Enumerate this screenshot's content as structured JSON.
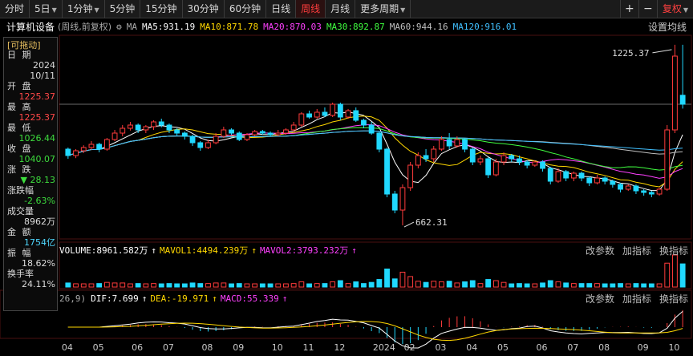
{
  "toolbar": {
    "periods": [
      "分时",
      "5日",
      "1分钟",
      "5分钟",
      "15分钟",
      "30分钟",
      "60分钟",
      "日线",
      "周线",
      "月线",
      "更多周期"
    ],
    "active": "周线",
    "fuquan": "复权",
    "plus": "+",
    "minus": "−"
  },
  "header": {
    "stock_name": "计算机设备",
    "period_note": "(周线,前复权)",
    "ma_label": "MA",
    "ma": [
      {
        "label": "MA5:931.19",
        "color": "#ffffff"
      },
      {
        "label": "MA10:871.78",
        "color": "#ffd700"
      },
      {
        "label": "MA20:870.03",
        "color": "#ff40ff"
      },
      {
        "label": "MA30:892.87",
        "color": "#40ff40"
      },
      {
        "label": "MA60:944.16",
        "color": "#c0c0c0"
      },
      {
        "label": "MA120:916.01",
        "color": "#40c0ff"
      }
    ],
    "settings": "设置均线"
  },
  "panel": {
    "drag": "[可拖动]",
    "date_label": "日  期",
    "year": "2024",
    "date": "10/11",
    "open_label": "开  盘",
    "open": "1225.37",
    "high_label": "最  高",
    "high": "1225.37",
    "low_label": "最  低",
    "low": "1026.44",
    "close_label": "收  盘",
    "close": "1040.07",
    "change_label": "涨  跌",
    "change": "▼ 28.13",
    "pct_label": "涨跌幅",
    "pct": "-2.63%",
    "vol_label": "成交量",
    "vol": "8962万",
    "amount_label": "金  额",
    "amount": "1754亿",
    "amp_label": "振  幅",
    "amp": "18.62%",
    "turnover_label": "换手率",
    "turnover": "24.11%"
  },
  "chart_data": {
    "type": "candlestick",
    "annotations": {
      "high": "1225.37",
      "low": "662.31"
    },
    "price_range": [
      640,
      1240
    ],
    "candles": [
      [
        900,
        880,
        905,
        870
      ],
      [
        880,
        895,
        900,
        872
      ],
      [
        895,
        905,
        912,
        888
      ],
      [
        905,
        915,
        925,
        898
      ],
      [
        915,
        900,
        920,
        890
      ],
      [
        900,
        930,
        935,
        895
      ],
      [
        930,
        950,
        960,
        925
      ],
      [
        950,
        965,
        975,
        940
      ],
      [
        965,
        975,
        985,
        958
      ],
      [
        975,
        960,
        980,
        950
      ],
      [
        960,
        970,
        975,
        950
      ],
      [
        970,
        985,
        990,
        960
      ],
      [
        985,
        975,
        995,
        968
      ],
      [
        975,
        960,
        980,
        950
      ],
      [
        960,
        950,
        965,
        940
      ],
      [
        950,
        940,
        955,
        930
      ],
      [
        940,
        920,
        945,
        910
      ],
      [
        920,
        905,
        925,
        895
      ],
      [
        905,
        920,
        930,
        900
      ],
      [
        920,
        940,
        950,
        915
      ],
      [
        940,
        960,
        970,
        935
      ],
      [
        960,
        950,
        965,
        945
      ],
      [
        950,
        930,
        955,
        925
      ],
      [
        930,
        945,
        950,
        925
      ],
      [
        945,
        955,
        960,
        940
      ],
      [
        955,
        950,
        960,
        945
      ],
      [
        950,
        945,
        955,
        940
      ],
      [
        945,
        950,
        960,
        940
      ],
      [
        950,
        960,
        965,
        945
      ],
      [
        960,
        975,
        985,
        955
      ],
      [
        975,
        1010,
        1015,
        970
      ],
      [
        1010,
        1000,
        1020,
        995
      ],
      [
        1000,
        1015,
        1025,
        995
      ],
      [
        1015,
        1005,
        1030,
        1000
      ],
      [
        1005,
        1040,
        1045,
        1000
      ],
      [
        1040,
        1000,
        1045,
        990
      ],
      [
        1000,
        1020,
        1025,
        995
      ],
      [
        1020,
        990,
        1030,
        985
      ],
      [
        990,
        975,
        995,
        965
      ],
      [
        975,
        950,
        985,
        945
      ],
      [
        950,
        900,
        955,
        890
      ],
      [
        900,
        760,
        905,
        750
      ],
      [
        760,
        710,
        770,
        700
      ],
      [
        710,
        780,
        790,
        662.31
      ],
      [
        780,
        850,
        860,
        770
      ],
      [
        850,
        880,
        890,
        840
      ],
      [
        880,
        870,
        900,
        860
      ],
      [
        870,
        900,
        910,
        860
      ],
      [
        900,
        930,
        940,
        895
      ],
      [
        930,
        910,
        950,
        900
      ],
      [
        910,
        930,
        940,
        905
      ],
      [
        930,
        900,
        935,
        890
      ],
      [
        900,
        860,
        905,
        850
      ],
      [
        860,
        870,
        880,
        850
      ],
      [
        870,
        820,
        875,
        810
      ],
      [
        820,
        860,
        870,
        815
      ],
      [
        860,
        880,
        890,
        850
      ],
      [
        880,
        870,
        885,
        860
      ],
      [
        870,
        860,
        880,
        850
      ],
      [
        860,
        850,
        865,
        840
      ],
      [
        850,
        860,
        865,
        845
      ],
      [
        860,
        840,
        865,
        830
      ],
      [
        840,
        800,
        845,
        790
      ],
      [
        800,
        830,
        840,
        795
      ],
      [
        830,
        810,
        835,
        800
      ],
      [
        810,
        825,
        830,
        800
      ],
      [
        825,
        810,
        830,
        800
      ],
      [
        810,
        795,
        815,
        785
      ],
      [
        795,
        810,
        820,
        790
      ],
      [
        810,
        800,
        815,
        790
      ],
      [
        800,
        790,
        805,
        780
      ],
      [
        790,
        775,
        795,
        765
      ],
      [
        775,
        785,
        790,
        770
      ],
      [
        785,
        770,
        790,
        760
      ],
      [
        770,
        765,
        775,
        755
      ],
      [
        765,
        760,
        770,
        750
      ],
      [
        760,
        775,
        780,
        755
      ],
      [
        775,
        960,
        975,
        770
      ],
      [
        960,
        1190,
        1225.37,
        950
      ],
      [
        1068,
        1040,
        1225.37,
        1026.44
      ]
    ],
    "volume_panel": {
      "labels": {
        "volume": "VOLUME:8961.582万",
        "mavol1": "MAVOL1:4494.239万",
        "mavol2": "MAVOL2:3793.232万"
      },
      "actions": [
        "改参数",
        "加指标",
        "换指标"
      ]
    },
    "macd_panel": {
      "params": "26,9)",
      "labels": {
        "dif": "DIF:7.699",
        "dea": "DEA:-19.971",
        "macd": "MACD:55.339"
      },
      "actions": [
        "改参数",
        "加指标",
        "换指标"
      ]
    },
    "x_labels": [
      {
        "label": "04",
        "i": 0
      },
      {
        "label": "05",
        "i": 4
      },
      {
        "label": "06",
        "i": 9
      },
      {
        "label": "07",
        "i": 13
      },
      {
        "label": "08",
        "i": 18
      },
      {
        "label": "09",
        "i": 22
      },
      {
        "label": "10",
        "i": 27
      },
      {
        "label": "11",
        "i": 31
      },
      {
        "label": "12",
        "i": 35
      },
      {
        "label": "2024",
        "i": 40
      },
      {
        "label": "02",
        "i": 44
      },
      {
        "label": "03",
        "i": 48
      },
      {
        "label": "04",
        "i": 52
      },
      {
        "label": "05",
        "i": 56
      },
      {
        "label": "06",
        "i": 61
      },
      {
        "label": "07",
        "i": 65
      },
      {
        "label": "08",
        "i": 69
      },
      {
        "label": "09",
        "i": 74
      },
      {
        "label": "10",
        "i": 78
      }
    ]
  },
  "colors": {
    "up": "#ff3b3b",
    "down": "#20d8ff",
    "grid": "#4a1010"
  }
}
